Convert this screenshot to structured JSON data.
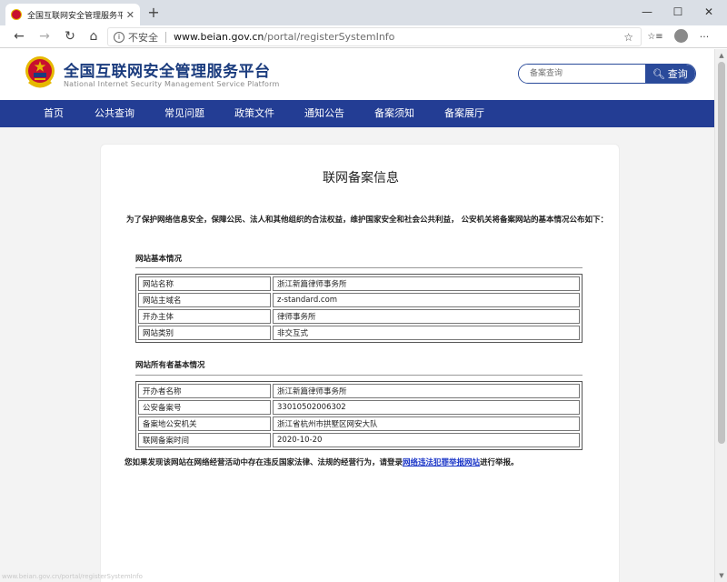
{
  "browser": {
    "tab_title": "全国互联网安全管理服务平台",
    "tab_close": "✕",
    "new_tab": "+",
    "window_controls": {
      "minimize": "—",
      "maximize": "☐",
      "close": "✕"
    },
    "nav": {
      "back": "←",
      "forward": "→",
      "reload": "↻",
      "home": "⌂"
    },
    "address": {
      "security_icon": "info-icon",
      "security_label": "不安全",
      "host": "www.beian.gov.cn",
      "path": "/portal/registerSystemInfo"
    },
    "favorite_star": "☆",
    "collections": "☆≡",
    "menu": "···",
    "status_url": "www.beian.gov.cn/portal/registerSystemInfo"
  },
  "site": {
    "title": "全国互联网安全管理服务平台",
    "subtitle": "National Internet Security Management Service Platform",
    "search_placeholder": "备案查询",
    "search_button": "查询",
    "nav": [
      "首页",
      "公共查询",
      "常见问题",
      "政策文件",
      "通知公告",
      "备案须知",
      "备案展厅"
    ]
  },
  "card": {
    "title": "联网备案信息",
    "intro": "为了保护网络信息安全，保障公民、法人和其他组织的合法权益，维护国家安全和社会公共利益， 公安机关将备案网站的基本情况公布如下：",
    "section1": {
      "heading": "网站基本情况",
      "rows": [
        {
          "label": "网站名称",
          "value": "浙江新篇律师事务所"
        },
        {
          "label": "网站主域名",
          "value": "z-standard.com"
        },
        {
          "label": "开办主体",
          "value": "律师事务所"
        },
        {
          "label": "网站类别",
          "value": "非交互式"
        }
      ]
    },
    "section2": {
      "heading": "网站所有者基本情况",
      "rows": [
        {
          "label": "开办者名称",
          "value": "浙江新篇律师事务所"
        },
        {
          "label": "公安备案号",
          "value": "33010502006302"
        },
        {
          "label": "备案地公安机关",
          "value": "浙江省杭州市拱墅区网安大队"
        },
        {
          "label": "联网备案时间",
          "value": "2020-10-20"
        }
      ]
    },
    "footnote_before": "您如果发现该网站在网络经营活动中存在违反国家法律、法规的经营行为，请登录",
    "footnote_link": "网络违法犯罪举报网站",
    "footnote_after": "进行举报。"
  },
  "colors": {
    "nav_bg": "#233d94",
    "title_blue": "#1b3c7e",
    "link": "#1a35c7",
    "emblem_red": "#c8102e",
    "emblem_gold": "#e6b800"
  }
}
